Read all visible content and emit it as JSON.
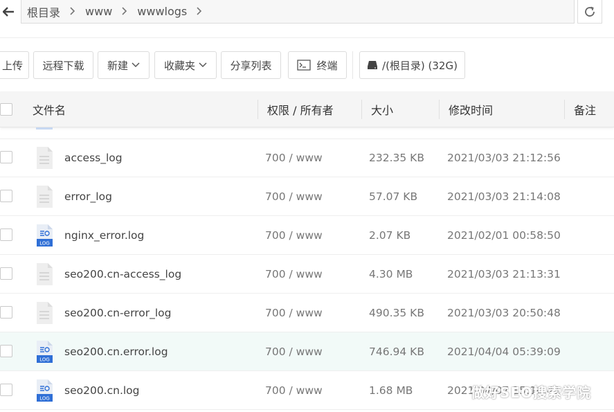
{
  "breadcrumb": [
    "根目录",
    "www",
    "wwwlogs"
  ],
  "toolbar": {
    "upload": "上传",
    "remote_download": "远程下载",
    "new": "新建",
    "favorites": "收藏夹",
    "share_list": "分享列表",
    "terminal": "终端",
    "disk": "/(根目录) (32G)"
  },
  "table": {
    "columns": {
      "name": "文件名",
      "owner": "权限 / 所有者",
      "size": "大小",
      "modified": "修改时间",
      "note": "备注"
    },
    "rows": [
      {
        "name": "access_log",
        "perm": "700 / www",
        "size": "232.35 KB",
        "modified": "2021/03/03 21:12:56",
        "icon": "generic-file-icon"
      },
      {
        "name": "error_log",
        "perm": "700 / www",
        "size": "57.07 KB",
        "modified": "2021/03/03 21:14:08",
        "icon": "generic-file-icon"
      },
      {
        "name": "nginx_error.log",
        "perm": "700 / www",
        "size": "2.07 KB",
        "modified": "2021/02/01 00:58:50",
        "icon": "log-file-icon"
      },
      {
        "name": "seo200.cn-access_log",
        "perm": "700 / www",
        "size": "4.30 MB",
        "modified": "2021/03/03 21:13:31",
        "icon": "generic-file-icon"
      },
      {
        "name": "seo200.cn-error_log",
        "perm": "700 / www",
        "size": "490.35 KB",
        "modified": "2021/03/03 20:50:48",
        "icon": "generic-file-icon"
      },
      {
        "name": "seo200.cn.error.log",
        "perm": "700 / www",
        "size": "746.94 KB",
        "modified": "2021/04/04 05:39:09",
        "icon": "log-file-icon"
      },
      {
        "name": "seo200.cn.log",
        "perm": "700 / www",
        "size": "1.68 MB",
        "modified": "2021/04/07 15:10:41",
        "icon": "log-file-icon"
      }
    ]
  },
  "log_badge": "LOG",
  "watermark": "做好SEO搜索学院",
  "colors": {
    "highlight_row": "#f2faf8",
    "log_icon": "#2f6fd6",
    "header_bg": "#f5f5f5"
  }
}
